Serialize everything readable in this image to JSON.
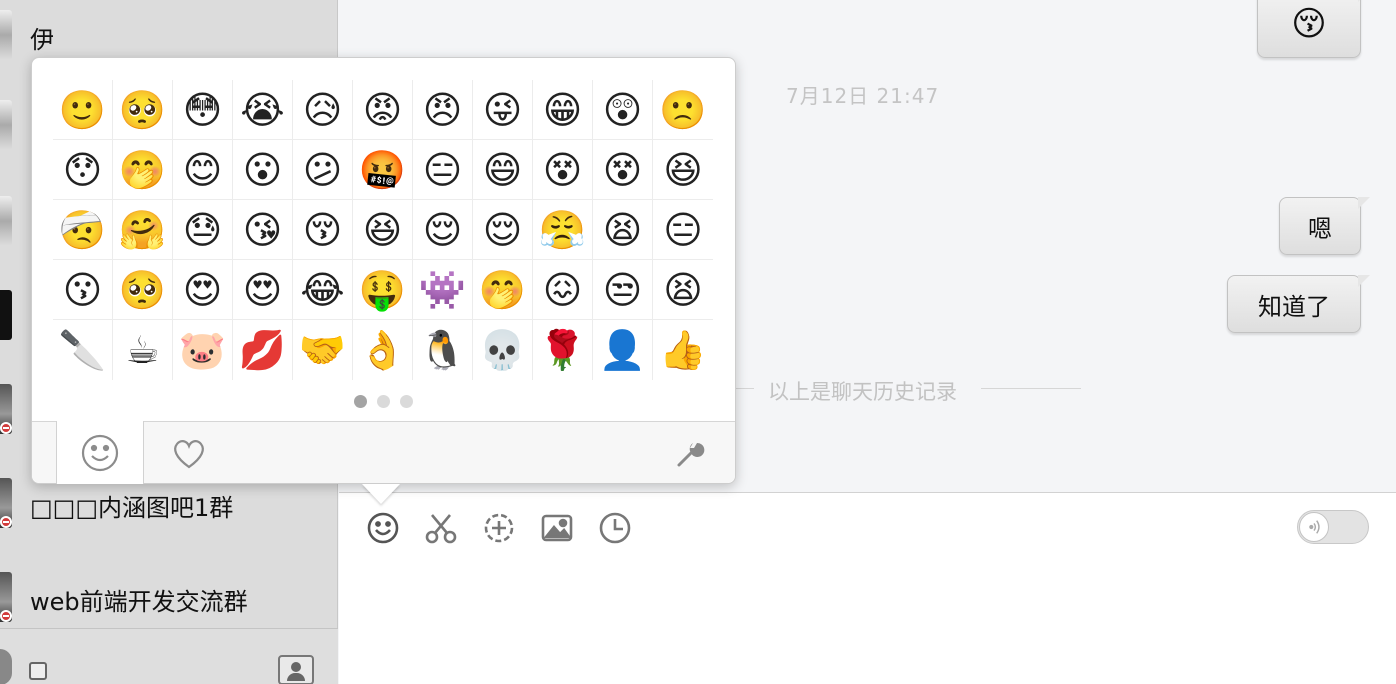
{
  "sidebar": {
    "conversations": [
      {
        "label": "伊",
        "avatar": "grayscale-photo"
      },
      {
        "label": "",
        "avatar": "grayscale-photo"
      },
      {
        "label": "",
        "avatar": "grayscale-photo"
      },
      {
        "label": "",
        "avatar": "dark-photo"
      },
      {
        "label": "",
        "avatar": "photo",
        "blocked": true
      },
      {
        "label": "□□□内涵图吧1群",
        "avatar": "photo",
        "blocked": true
      },
      {
        "label": "web前端开发交流群",
        "avatar": "photo",
        "blocked": true
      }
    ],
    "footer": {
      "checkbox_icon": "checkbox-icon",
      "contacts_icon": "contact-card-icon"
    }
  },
  "chat": {
    "messages": [
      {
        "type": "emoji",
        "content": "😚",
        "side": "right"
      },
      {
        "type": "timestamp",
        "content": "7月12日  21:47"
      },
      {
        "type": "text",
        "content": "嗯",
        "side": "right"
      },
      {
        "type": "text",
        "content": "知道了",
        "side": "right"
      }
    ],
    "history_divider": "以上是聊天历史记录"
  },
  "toolbar": {
    "items": [
      {
        "name": "emoji-tool",
        "icon": "smiley-icon"
      },
      {
        "name": "screenshot-tool",
        "icon": "scissors-icon"
      },
      {
        "name": "capture-tool",
        "icon": "crosshair-icon"
      },
      {
        "name": "image-tool",
        "icon": "image-icon"
      },
      {
        "name": "history-tool",
        "icon": "clock-icon"
      }
    ],
    "voice_toggle_icon": "sound-wave-icon"
  },
  "emoji_panel": {
    "emojis": [
      "🙂",
      "🥺",
      "😳",
      "😭",
      "😥",
      "😡",
      "😠",
      "😜",
      "😁",
      "😲",
      "🙁",
      "😯",
      "🤭",
      "😊",
      "😮",
      "😕",
      "🤬",
      "😑",
      "😄",
      "😵",
      "😵",
      "😆",
      "🤕",
      "🤗",
      "😓",
      "😘",
      "😚",
      "😆",
      "😌",
      "😌",
      "😤",
      "😫",
      "😑",
      "😗",
      "🥺",
      "😍",
      "😍",
      "😂",
      "🤑",
      "👾",
      "🤭",
      "😖",
      "😒",
      "😫",
      "🔪",
      "☕",
      "🐷",
      "💋",
      "🤝",
      "👌",
      "🐧",
      "💀",
      "🌹",
      "👤",
      "👍"
    ],
    "pages": 3,
    "current_page": 1,
    "tabs": [
      {
        "name": "smiley",
        "icon": "smiley-icon",
        "active": true
      },
      {
        "name": "favorites",
        "icon": "heart-icon",
        "active": false
      }
    ],
    "settings_icon": "wrench-icon"
  }
}
